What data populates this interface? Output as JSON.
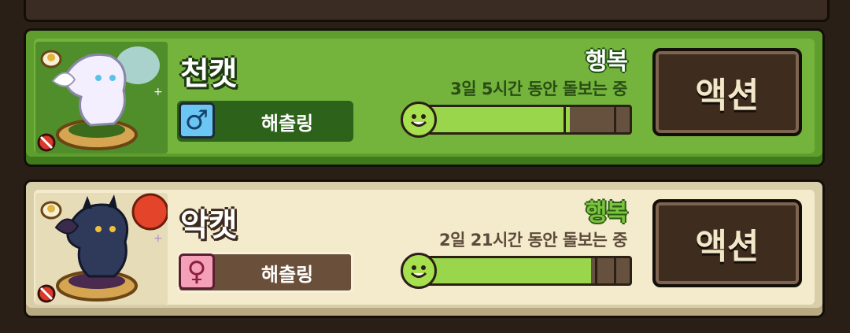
{
  "pets": [
    {
      "name": "천캣",
      "gender_symbol": "♂",
      "gender": "male",
      "breed": "해츨링",
      "status": "행복",
      "care_time": "3일 5시간 동안 돌보는 중",
      "happiness": 0.72,
      "action_label": "액션",
      "theme": "green",
      "portrait_icon": "angel-cat-sprite"
    },
    {
      "name": "악캣",
      "gender_symbol": "♀",
      "gender": "female",
      "breed": "해츨링",
      "status": "행복",
      "care_time": "2일 21시간 동안 돌보는 중",
      "happiness": 0.82,
      "action_label": "액션",
      "theme": "cream",
      "portrait_icon": "devil-cat-sprite"
    }
  ],
  "colors": {
    "card_green": "#74b43d",
    "card_cream": "#f3ebcc",
    "bar_fill": "#9ad64b",
    "button_bg": "#3e2c1f"
  }
}
